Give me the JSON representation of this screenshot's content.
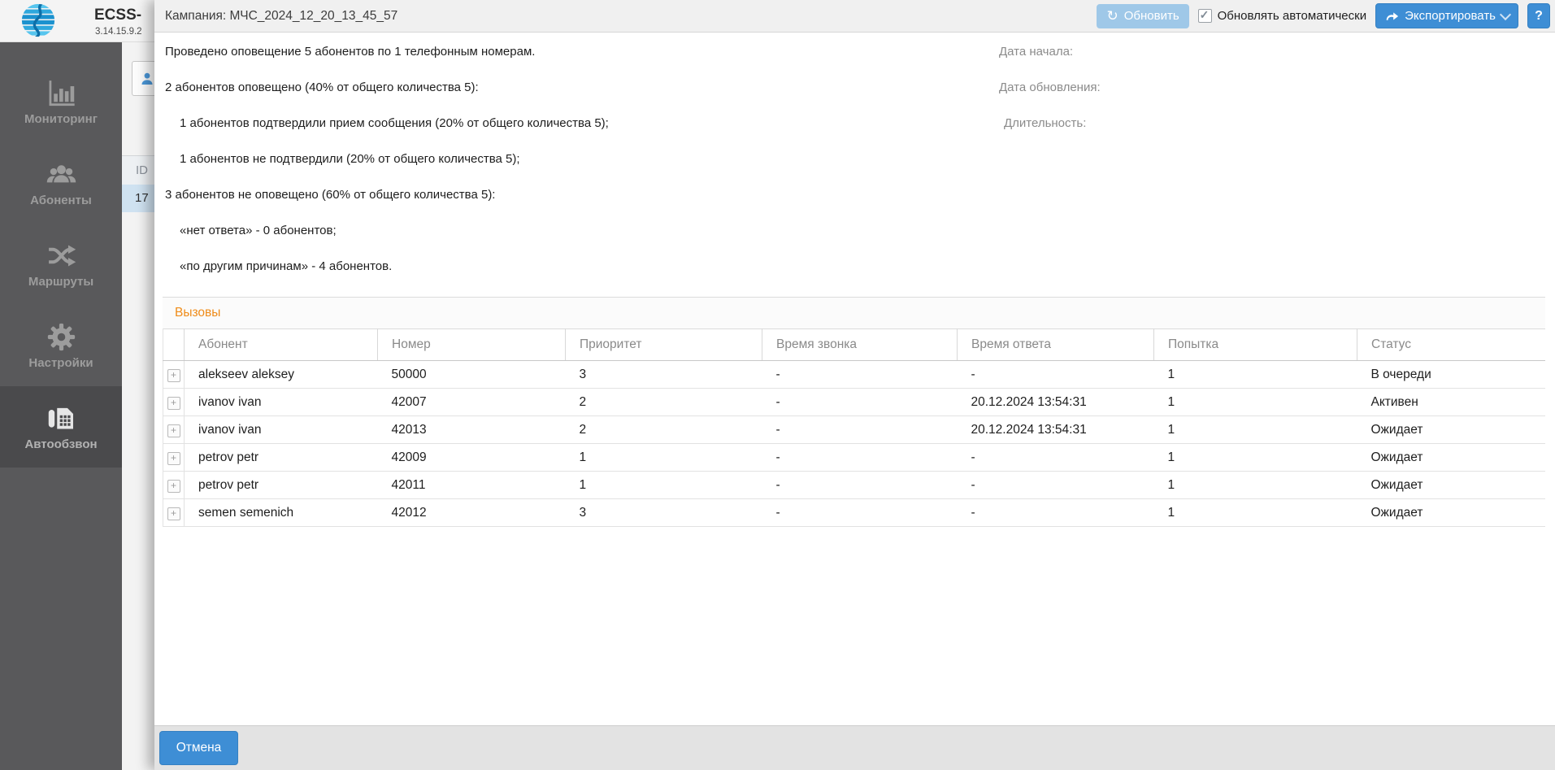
{
  "header": {
    "app_name": "ECSS-",
    "version": "3.14.15.9.2"
  },
  "sidebar": {
    "items": [
      {
        "id": "monitoring",
        "label": "Мониторинг",
        "icon": "monitoring-chart-icon",
        "active": false
      },
      {
        "id": "subscribers",
        "label": "Абоненты",
        "icon": "subscribers-icon",
        "active": false
      },
      {
        "id": "routes",
        "label": "Маршруты",
        "icon": "routes-shuffle-icon",
        "active": false
      },
      {
        "id": "settings",
        "label": "Настройки",
        "icon": "settings-gear-icon",
        "active": false
      },
      {
        "id": "autodial",
        "label": "Автообзвон",
        "icon": "autodial-phone-icon",
        "active": true
      }
    ]
  },
  "background_page": {
    "toolbar_icon": "person-icon",
    "id_column_header": "ID",
    "selected_row_id": "17"
  },
  "modal": {
    "title": "Кампания: МЧС_2024_12_20_13_45_57",
    "toolbar": {
      "refresh_label": "Обновить",
      "refresh_icon": "refresh-icon",
      "auto_refresh_label": "Обновлять автоматически",
      "auto_refresh_checked": true,
      "export_label": "Экспортировать",
      "export_icon": "export-arrow-icon",
      "help_label": "?"
    },
    "summary": {
      "lines": [
        {
          "text": "Проведено оповещение 5 абонентов по 1 телефонным номерам.",
          "indent": false
        },
        {
          "text": "2 абонентов оповещено (40% от общего количества 5):",
          "indent": false
        },
        {
          "text": "1 абонентов подтвердили прием сообщения (20% от общего количества 5);",
          "indent": true
        },
        {
          "text": "1 абонентов не подтвердили (20% от общего количества 5);",
          "indent": true
        },
        {
          "text": "3 абонентов не оповещено (60% от общего количества 5):",
          "indent": false
        },
        {
          "text": "«нет ответа» - 0 абонентов;",
          "indent": true
        },
        {
          "text": "«по другим причинам» - 4 абонентов.",
          "indent": true
        }
      ]
    },
    "meta_labels": [
      {
        "label": "Дата начала:",
        "value": ""
      },
      {
        "label": "Дата обновления:",
        "value": ""
      },
      {
        "label": "Длительность:",
        "value": ""
      }
    ],
    "calls": {
      "section_title": "Вызовы",
      "columns": [
        "Абонент",
        "Номер",
        "Приоритет",
        "Время звонка",
        "Время ответа",
        "Попытка",
        "Статус"
      ],
      "rows": [
        {
          "subscriber": "alekseev aleksey",
          "number": "50000",
          "priority": "3",
          "call_time": "-",
          "answer_time": "-",
          "attempt": "1",
          "status": "В очереди"
        },
        {
          "subscriber": "ivanov ivan",
          "number": "42007",
          "priority": "2",
          "call_time": "-",
          "answer_time": "20.12.2024 13:54:31",
          "attempt": "1",
          "status": "Активен"
        },
        {
          "subscriber": "ivanov ivan",
          "number": "42013",
          "priority": "2",
          "call_time": "-",
          "answer_time": "20.12.2024 13:54:31",
          "attempt": "1",
          "status": "Ожидает"
        },
        {
          "subscriber": "petrov petr",
          "number": "42009",
          "priority": "1",
          "call_time": "-",
          "answer_time": "-",
          "attempt": "1",
          "status": "Ожидает"
        },
        {
          "subscriber": "petrov petr",
          "number": "42011",
          "priority": "1",
          "call_time": "-",
          "answer_time": "-",
          "attempt": "1",
          "status": "Ожидает"
        },
        {
          "subscriber": "semen semenich",
          "number": "42012",
          "priority": "3",
          "call_time": "-",
          "answer_time": "-",
          "attempt": "1",
          "status": "Ожидает"
        }
      ]
    },
    "footer": {
      "cancel_label": "Отмена"
    }
  },
  "colors": {
    "accent_blue": "#3e8ed5",
    "disabled_blue": "#9fc8e8",
    "orange_section": "#ef8c1a",
    "sidebar_bg": "#59595b",
    "sidebar_active_bg": "#4a4a4c",
    "selected_row_bg": "#cfe2f1"
  }
}
